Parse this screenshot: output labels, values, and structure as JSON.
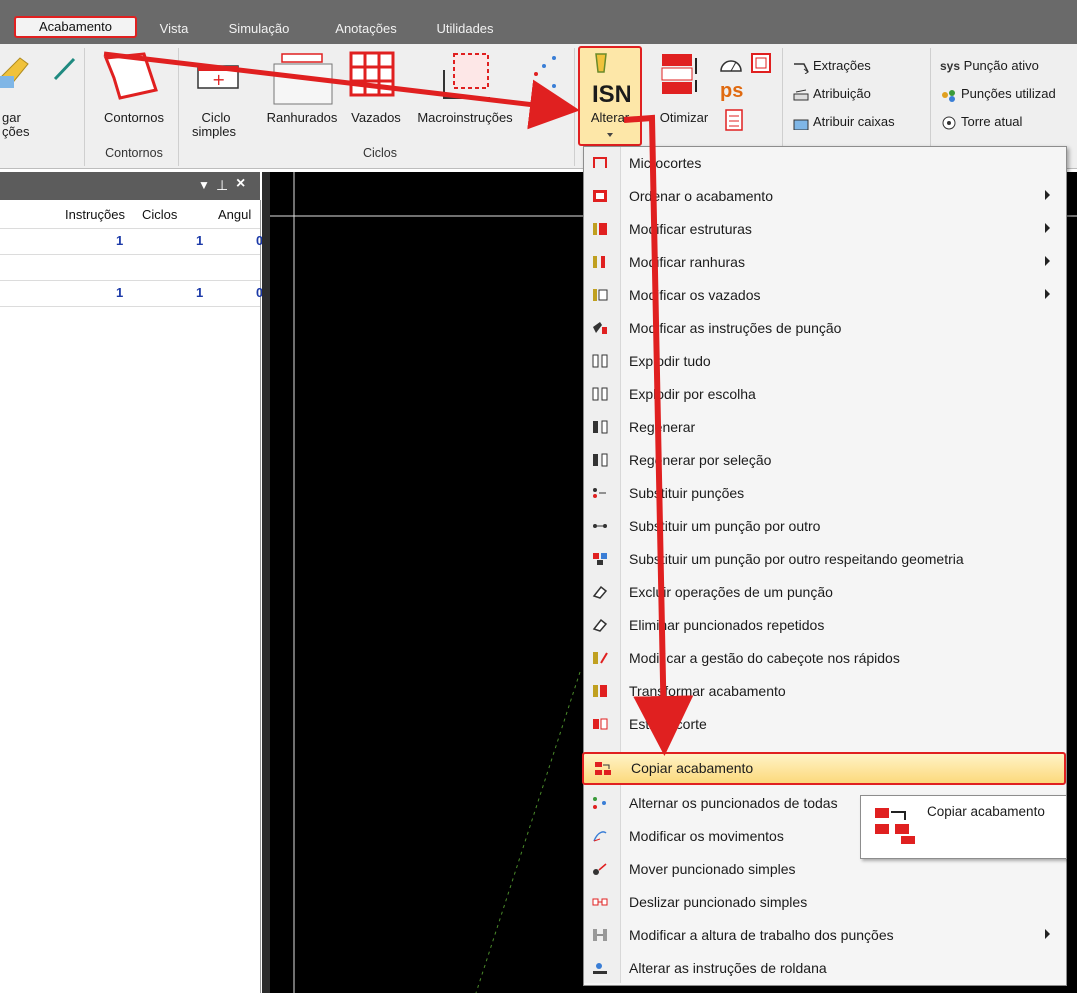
{
  "menubar": {
    "tabs": [
      {
        "label": "Acabamento",
        "active": true
      },
      {
        "label": "Vista"
      },
      {
        "label": "Simulação"
      },
      {
        "label": "Anotações"
      },
      {
        "label": "Utilidades"
      }
    ]
  },
  "ribbon": {
    "partial_left_line1": "gar",
    "partial_left_line2": "ções",
    "contornos_btn": "Contornos",
    "contornos_group": "Contornos",
    "ciclo_line1": "Ciclo",
    "ciclo_line2": "simples",
    "ranhurados": "Ranhurados",
    "vazados": "Vazados",
    "macro": "Macroinstruções",
    "ciclos_group": "Ciclos",
    "alterar": "Alterar",
    "alterar_icon_text": "ISN",
    "otimizar": "Otimizar",
    "ps_text": "ps",
    "extracoes": "Extrações",
    "atribuicao": "Atribuição",
    "atribuir_caixas": "Atribuir caixas",
    "sys_text": "sys",
    "puncao_ativo": "Punção ativo",
    "puncoes_utilizados": "Punções utilizad",
    "torre_atual": "Torre atual"
  },
  "panel": {
    "headers": [
      "Instruções",
      "Ciclos",
      "Angul"
    ],
    "rows": [
      {
        "instrucoes": "1",
        "ciclos": "1",
        "ang": "0"
      },
      {
        "instrucoes": "",
        "ciclos": "",
        "ang": ""
      },
      {
        "instrucoes": "1",
        "ciclos": "1",
        "ang": "0"
      }
    ]
  },
  "context_menu": {
    "items": [
      {
        "label": "Microcortes",
        "submenu": false
      },
      {
        "label": "Ordenar o acabamento",
        "submenu": true
      },
      {
        "label": "Modificar estruturas",
        "submenu": true
      },
      {
        "label": "Modificar ranhuras",
        "submenu": true
      },
      {
        "label": "Modificar os vazados",
        "submenu": true
      },
      {
        "label": "Modificar as instruções de punção",
        "submenu": false
      },
      {
        "label": "Explodir tudo",
        "submenu": false
      },
      {
        "label": "Explodir por escolha",
        "submenu": false
      },
      {
        "label": "Regenerar",
        "submenu": false
      },
      {
        "label": "Regenerar por seleção",
        "submenu": false
      },
      {
        "label": "Substituir punções",
        "submenu": false
      },
      {
        "label": "Substituir um punção por outro",
        "submenu": false
      },
      {
        "label": "Substituir um punção por outro respeitando geometria",
        "submenu": false
      },
      {
        "label": "Excluir operações de um punção",
        "submenu": false
      },
      {
        "label": "Eliminar puncionados repetidos",
        "submenu": false
      },
      {
        "label": "Modificar a gestão do cabeçote nos rápidos",
        "submenu": false
      },
      {
        "label": "Transformar acabamento",
        "submenu": false
      },
      {
        "label": "Esticar corte",
        "submenu": false
      },
      {
        "label": "Copiar acabamento",
        "submenu": false,
        "highlighted": true
      },
      {
        "label": "Alternar os puncionados de todas",
        "submenu": false
      },
      {
        "label": "Modificar os movimentos",
        "submenu": false
      },
      {
        "label": "Mover puncionado simples",
        "submenu": false
      },
      {
        "label": "Deslizar puncionado simples",
        "submenu": false
      },
      {
        "label": "Modificar a altura de trabalho dos punções",
        "submenu": true
      },
      {
        "label": "Alterar as instruções de roldana",
        "submenu": false
      }
    ]
  },
  "tooltip": {
    "label": "Copiar acabamento"
  },
  "colors": {
    "accent_red": "#e02020",
    "highlight_yellow": "#fcd97c",
    "value_blue": "#1c3aa8"
  }
}
